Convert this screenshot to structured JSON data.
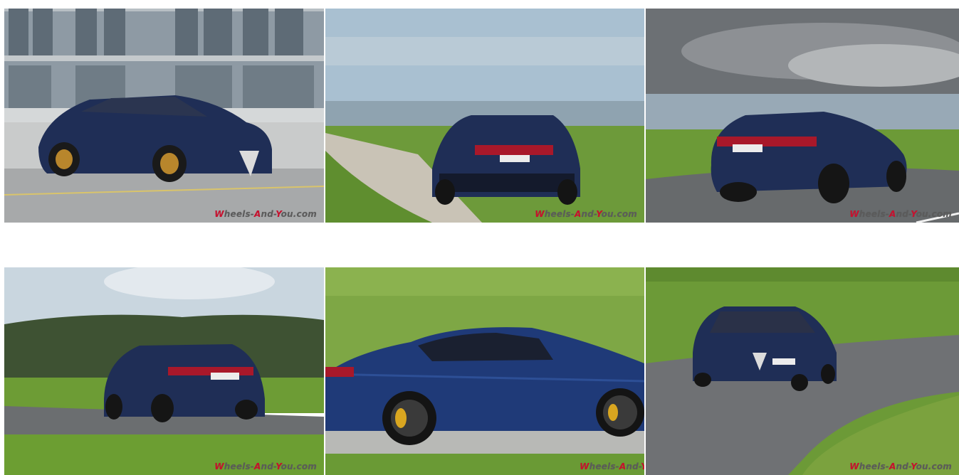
{
  "gallery": {
    "watermark": {
      "letter_w": "W",
      "part_heels": "heels-",
      "letter_a": "A",
      "part_nd": "nd-",
      "letter_y": "Y",
      "part_ou": "ou.com"
    },
    "watermark_cut": {
      "letter_w": "W",
      "part_heels": "heels-",
      "letter_a": "A",
      "part_nd": "nd-",
      "letter_y": "Y"
    }
  },
  "colors": {
    "car_blue": "#1f2e56",
    "watermark_red": "#c8102e",
    "watermark_gray": "#5b5b5b"
  }
}
